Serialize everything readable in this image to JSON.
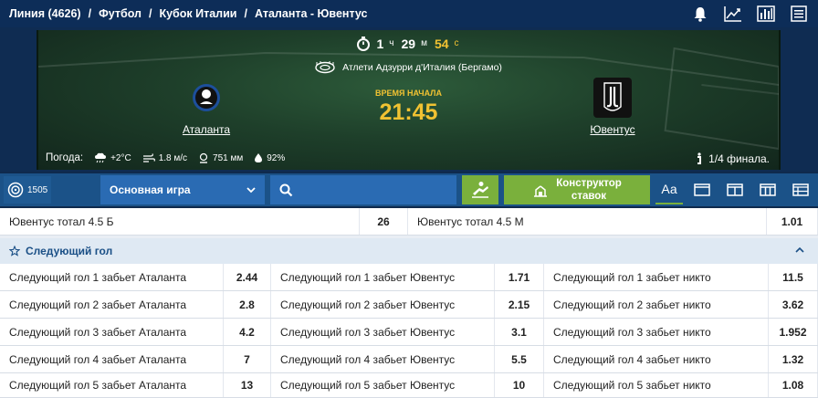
{
  "breadcrumbs": [
    "Линия (4626)",
    "Футбол",
    "Кубок Италии",
    "Аталанта - Ювентус"
  ],
  "header_icons": [
    "bell-icon",
    "chart-line-icon",
    "stats-bars-icon",
    "list-icon"
  ],
  "match": {
    "timer": {
      "hours": "1",
      "hours_unit": "ч",
      "minutes": "29",
      "minutes_unit": "м",
      "seconds": "54",
      "seconds_unit": "с"
    },
    "stadium": "Атлети Адзурри д'Италия (Бергамо)",
    "home_team": "Аталанта",
    "away_team": "Ювентус",
    "start_label": "ВРЕМЯ НАЧАЛА",
    "start_time": "21:45",
    "weather_label": "Погода:",
    "weather": {
      "temp": "+2°C",
      "wind": "1.8 м/с",
      "pressure": "751 мм",
      "humidity": "92%"
    },
    "stage": "1/4 финала."
  },
  "toolbar": {
    "count": "1505",
    "select_value": "Основная игра",
    "builder_label_1": "Конструктор",
    "builder_label_2": "ставок",
    "font_btn": "Аа"
  },
  "total_row": {
    "left_label": "Ювентус тотал 4.5 Б",
    "left_odd": "26",
    "right_label": "Ювентус тотал 4.5 М",
    "right_odd": "1.01"
  },
  "section": {
    "title": "Следующий гол",
    "rows": [
      {
        "a_label": "Следующий гол 1 забьет Аталанта",
        "a_odd": "2.44",
        "b_label": "Следующий гол 1 забьет Ювентус",
        "b_odd": "1.71",
        "c_label": "Следующий гол 1 забьет никто",
        "c_odd": "11.5"
      },
      {
        "a_label": "Следующий гол 2 забьет Аталанта",
        "a_odd": "2.8",
        "b_label": "Следующий гол 2 забьет Ювентус",
        "b_odd": "2.15",
        "c_label": "Следующий гол 2 забьет никто",
        "c_odd": "3.62"
      },
      {
        "a_label": "Следующий гол 3 забьет Аталанта",
        "a_odd": "4.2",
        "b_label": "Следующий гол 3 забьет Ювентус",
        "b_odd": "3.1",
        "c_label": "Следующий гол 3 забьет никто",
        "c_odd": "1.952"
      },
      {
        "a_label": "Следующий гол 4 забьет Аталанта",
        "a_odd": "7",
        "b_label": "Следующий гол 4 забьет Ювентус",
        "b_odd": "5.5",
        "c_label": "Следующий гол 4 забьет никто",
        "c_odd": "1.32"
      },
      {
        "a_label": "Следующий гол 5 забьет Аталанта",
        "a_odd": "13",
        "b_label": "Следующий гол 5 забьет Ювентус",
        "b_odd": "10",
        "c_label": "Следующий гол 5 забьет никто",
        "c_odd": "1.08"
      }
    ]
  },
  "colors": {
    "accent_green": "#7ab03c",
    "accent_gold": "#f1c232",
    "navy": "#0d2d58"
  }
}
